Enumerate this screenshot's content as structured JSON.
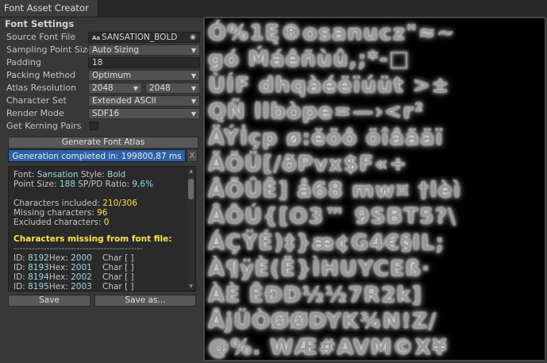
{
  "window": {
    "tab_title": "Font Asset Creator"
  },
  "settings": {
    "section_title": "Font Settings",
    "source_font_file": {
      "label": "Source Font File",
      "value": "SANSATION_BOLD",
      "icon": "font-asset-icon"
    },
    "sampling_point_size": {
      "label": "Sampling Point Size",
      "value": "Auto Sizing"
    },
    "padding": {
      "label": "Padding",
      "value": "18"
    },
    "packing_method": {
      "label": "Packing Method",
      "value": "Optimum"
    },
    "atlas_resolution": {
      "label": "Atlas Resolution",
      "width": "2048",
      "height": "2048"
    },
    "character_set": {
      "label": "Character Set",
      "value": "Extended ASCII"
    },
    "render_mode": {
      "label": "Render Mode",
      "value": "SDF16"
    },
    "get_kerning_pairs": {
      "label": "Get Kerning Pairs",
      "checked": false
    }
  },
  "generate_button": "Generate Font Atlas",
  "progress": {
    "text": "Generation completed in: 199800,87 ms",
    "fill": 1.0,
    "close_label": "X"
  },
  "report": {
    "font_label": "Font:",
    "font_name": "Sansation",
    "style_label": "Style:",
    "style_value": "Bold",
    "point_size_label": "Point Size:",
    "point_size_value": "188",
    "sp_pd_label": "SP/PD Ratio:",
    "sp_pd_value": "9,6%",
    "included_label": "Characters included:",
    "included_value": "210/306",
    "missing_label": "Missing characters:",
    "missing_value": "96",
    "excluded_label": "Excluded characters:",
    "excluded_value": "0",
    "missing_header": "Characters missing from font file:",
    "divider": "-------------------------------------------",
    "missing_rows": [
      {
        "id_label": "ID:",
        "id": "8192",
        "hex_label": "Hex:",
        "hex": "2000",
        "char": "Char [  ]"
      },
      {
        "id_label": "ID:",
        "id": "8193",
        "hex_label": "Hex:",
        "hex": "2001",
        "char": "Char [  ]"
      },
      {
        "id_label": "ID:",
        "id": "8194",
        "hex_label": "Hex:",
        "hex": "2002",
        "char": "Char [  ]"
      },
      {
        "id_label": "ID:",
        "id": "8195",
        "hex_label": "Hex:",
        "hex": "2003",
        "char": "Char [  ]"
      }
    ]
  },
  "buttons": {
    "save": "Save",
    "save_as": "Save as..."
  },
  "atlas_rows": [
    "Ó%1Ę®osanucz\"≈~",
    "gó Ḿáêñùû,;*-□",
    "ÙÍF dhqàéëïúüt >±",
    "QÑ llbòpe=—›<r²",
    "ÄÝİçp ø:ĕöô öîâãäï",
    "ÃÖÜ[/ðPvx$F«÷",
    "ÂÕÛÊ] å68 mw¤ †lèì",
    "ÂÔÚ{[O3™ 9SBT5?\\",
    "ÁÇŸÉ)‡}æ¢G4€§IL;",
    "À¶ÿÈ(Ë}ÌHUYCEß·",
    "ÀÈ ÊĐD½½7R2k]",
    "ÅjÜÒØØDYK¾N!Z/",
    "@%. WÆ#AVM©X¥"
  ]
}
